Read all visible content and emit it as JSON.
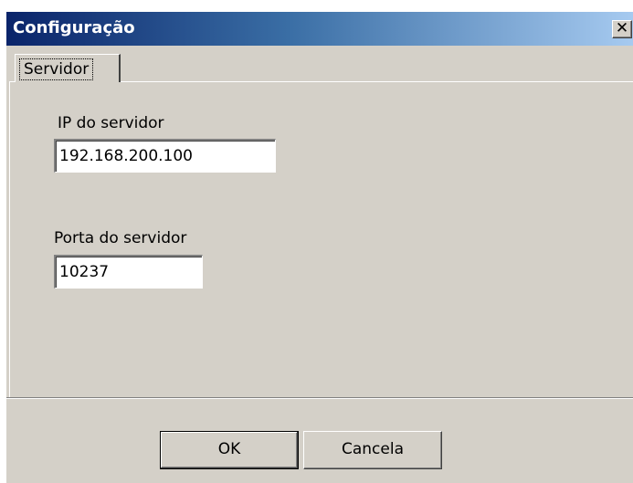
{
  "window": {
    "title": "Configuração",
    "close_icon_glyph": "✕"
  },
  "tabs": [
    {
      "label": "Servidor",
      "selected": true
    }
  ],
  "form": {
    "server_ip": {
      "label": "IP do servidor",
      "value": "192.168.200.100"
    },
    "server_port": {
      "label": "Porta do servidor",
      "value": "10237"
    }
  },
  "buttons": {
    "ok_label": "OK",
    "cancel_label": "Cancela"
  },
  "colors": {
    "face": "#d4d0c8",
    "title_start": "#0a246a",
    "title_end": "#a6caf0"
  }
}
